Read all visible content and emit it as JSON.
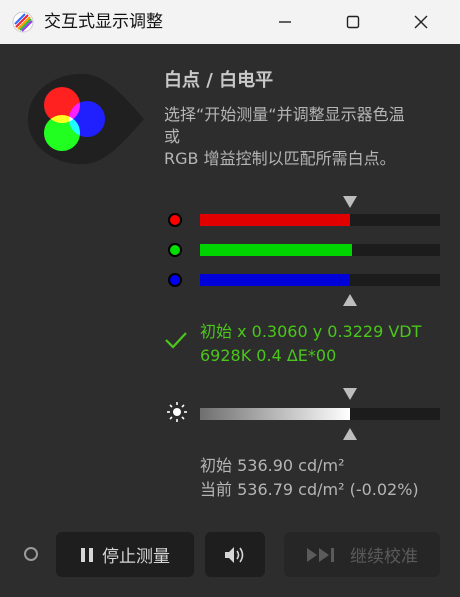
{
  "window": {
    "title": "交互式显示调整",
    "icon": "rainbow-swirl-icon",
    "controls": {
      "minimize": "minimize-icon",
      "maximize": "maximize-icon",
      "close": "close-icon"
    }
  },
  "header": {
    "heading": "白点 / 白电平",
    "description": "选择“开始测量“并调整显示器色温\n或\nRGB 增益控制以匹配所需白点。"
  },
  "rgb": {
    "channels": [
      {
        "name": "red",
        "color": "#ff0000",
        "fill_color": "#e10000",
        "level": 0.625
      },
      {
        "name": "green",
        "color": "#00e000",
        "fill_color": "#00d400",
        "level": 0.633
      },
      {
        "name": "blue",
        "color": "#0000ee",
        "fill_color": "#0000d8",
        "level": 0.625
      }
    ],
    "target_level": 0.625
  },
  "status": {
    "icon": "checkmark-icon",
    "line1": "初始 x 0.3060 y 0.3229 VDT",
    "line2": "6928K 0.4 ΔE*00",
    "color": "#4bc61a"
  },
  "luminance": {
    "icon": "sun-icon",
    "level": 0.625,
    "target_level": 0.625,
    "initial": "初始 536.90 cd/m²",
    "current": "当前 536.79 cd/m² (-0.02%)"
  },
  "buttons": {
    "stop_label": "停止测量",
    "stop_icon": "pause-icon",
    "sound_icon": "speaker-icon",
    "resume_label": "继续校准",
    "resume_icon": "skip-forward-icon"
  }
}
